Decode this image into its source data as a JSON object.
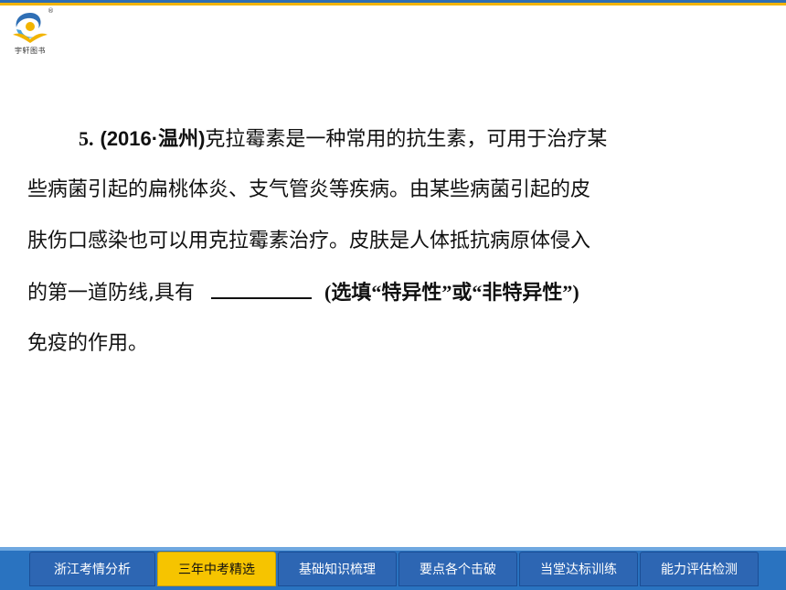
{
  "header": {
    "logo_text": "宇轩图书",
    "registered_mark": "®"
  },
  "question": {
    "number": "5.",
    "source": "(2016·温州)",
    "line1_rest": "克拉霉素是一种常用的抗生素，可用于治疗某",
    "line2": "些病菌引起的扁桃体炎、支气管炎等疾病。由某些病菌引起的皮",
    "line3": "肤伤口感染也可以用克拉霉素治疗。皮肤是人体抵抗病原体侵入",
    "line4_before_blank": "的第一道防线,具有",
    "line4_hint": "(选填“特异性”或“非特异性”)",
    "line5": "免疫的作用。"
  },
  "nav": {
    "tabs": [
      {
        "label": "浙江考情分析",
        "active": false
      },
      {
        "label": "三年中考精选",
        "active": true
      },
      {
        "label": "基础知识梳理",
        "active": false
      },
      {
        "label": "要点各个击破",
        "active": false
      },
      {
        "label": "当堂达标训练",
        "active": false
      },
      {
        "label": "能力评估检测",
        "active": false
      }
    ]
  },
  "colors": {
    "top_blue": "#2f6fb5",
    "top_yellow": "#f2b400",
    "nav_blue": "#2a73c0",
    "tab_active": "#f6c400"
  }
}
